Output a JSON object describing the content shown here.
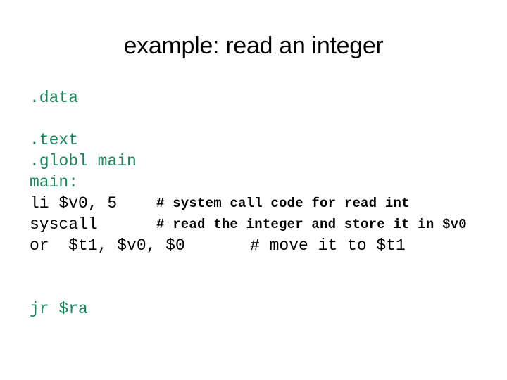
{
  "slide": {
    "title": "example: read an integer",
    "background_color": "#ffffff",
    "title_color": "#000000",
    "directive_color": "#17875a",
    "instruction_color": "#000000"
  },
  "code": {
    "lines": [
      {
        "text": ".data",
        "color": "green",
        "comment": null
      },
      {
        "text": "",
        "color": "green",
        "comment": null
      },
      {
        "text": ".text",
        "color": "green",
        "comment": null
      },
      {
        "text": ".globl main",
        "color": "green",
        "comment": null
      },
      {
        "text": "main:",
        "color": "green",
        "comment": null
      },
      {
        "text": "li $v0, 5",
        "color": "black",
        "comment": "# system call code for read_int"
      },
      {
        "text": "syscall",
        "color": "black",
        "comment": "# read the integer and store it in $v0"
      },
      {
        "text": "or  $t1, $v0, $0",
        "color": "black",
        "comment": "# move it to $t1"
      },
      {
        "text": "",
        "color": "black",
        "comment": null
      },
      {
        "text": "",
        "color": "black",
        "comment": null
      },
      {
        "text": "jr $ra",
        "color": "green",
        "comment": null
      }
    ]
  }
}
